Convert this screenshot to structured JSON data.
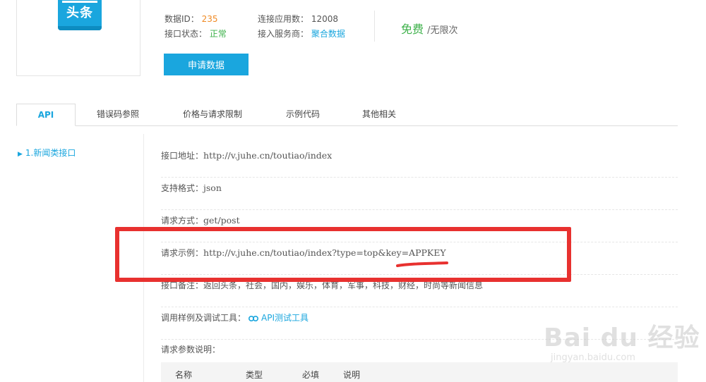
{
  "logo": {
    "brand_text": "头条"
  },
  "meta": {
    "data_id_label": "数据ID：",
    "data_id_value": "235",
    "status_label": "接口状态：",
    "status_value": "正常",
    "apps_label": "连接应用数：",
    "apps_value": "12008",
    "provider_label": "接入服务商：",
    "provider_value": "聚合数据"
  },
  "price": {
    "free": "免费",
    "limit": "/无限次"
  },
  "apply_button": "申请数据",
  "tabs": [
    {
      "label": "API",
      "active": true
    },
    {
      "label": "错误码参照"
    },
    {
      "label": "价格与请求限制"
    },
    {
      "label": "示例代码"
    },
    {
      "label": "其他相关"
    }
  ],
  "sidebar": {
    "items": [
      {
        "label": "1.新闻类接口"
      }
    ]
  },
  "api": {
    "url_label": "接口地址：",
    "url_value": "http://v.juhe.cn/toutiao/index",
    "format_label": "支持格式：",
    "format_value": "json",
    "method_label": "请求方式：",
    "method_value": "get/post",
    "example_label": "请求示例：",
    "example_value": "http://v.juhe.cn/toutiao/index?type=top&key=APPKEY",
    "note_text": "接口备注：返回头条，社会，国内，娱乐，体育，军事，科技，财经，时尚等新闻信息",
    "test_label": "调用样例及调试工具：",
    "test_link": "API测试工具",
    "params_title": "请求参数说明："
  },
  "param_table": {
    "headers": [
      "名称",
      "类型",
      "必填",
      "说明"
    ]
  },
  "watermark": {
    "big": "Bai du 经验",
    "small": "jingyan.baidu.com"
  },
  "colors": {
    "accent": "#1aa6de",
    "green": "#3db14a",
    "orange": "#f08a24",
    "annotation_red": "#e8312f"
  }
}
